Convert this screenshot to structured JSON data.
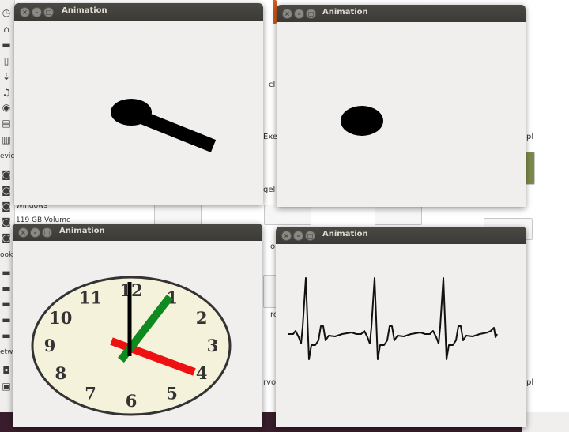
{
  "windows": [
    {
      "title": "Animation",
      "content": "pendulum"
    },
    {
      "title": "Animation",
      "content": "ball"
    },
    {
      "title": "Animation",
      "content": "clock"
    },
    {
      "title": "Animation",
      "content": "ecg"
    }
  ],
  "window_controls": {
    "close": "×",
    "minimize": "–",
    "maximize": "□"
  },
  "background": {
    "sidebar_labels": {
      "devices_header": "evic",
      "windows_volume": "Windows",
      "volume_119": "119 GB Volume",
      "bookmarks_header": "ook",
      "network_header": "etw"
    },
    "file_labels": {
      "cl": "cl",
      "exe": "Exe",
      "gel": "gel",
      "o": "o",
      "ro": "ro",
      "rvo": "rvo",
      "pl1": "pl",
      "pl2": "pl"
    }
  },
  "clock": {
    "numbers": [
      "12",
      "1",
      "2",
      "3",
      "4",
      "5",
      "6",
      "7",
      "8",
      "9",
      "10",
      "11"
    ],
    "face_color": "#f5f2dc",
    "hour_hand_color": "#ee1111",
    "minute_hand_color": "#0f8a1e",
    "second_hand_color": "#000000"
  },
  "pendulum_color": "#000000",
  "ball_color": "#000000",
  "ecg_color": "#111111"
}
